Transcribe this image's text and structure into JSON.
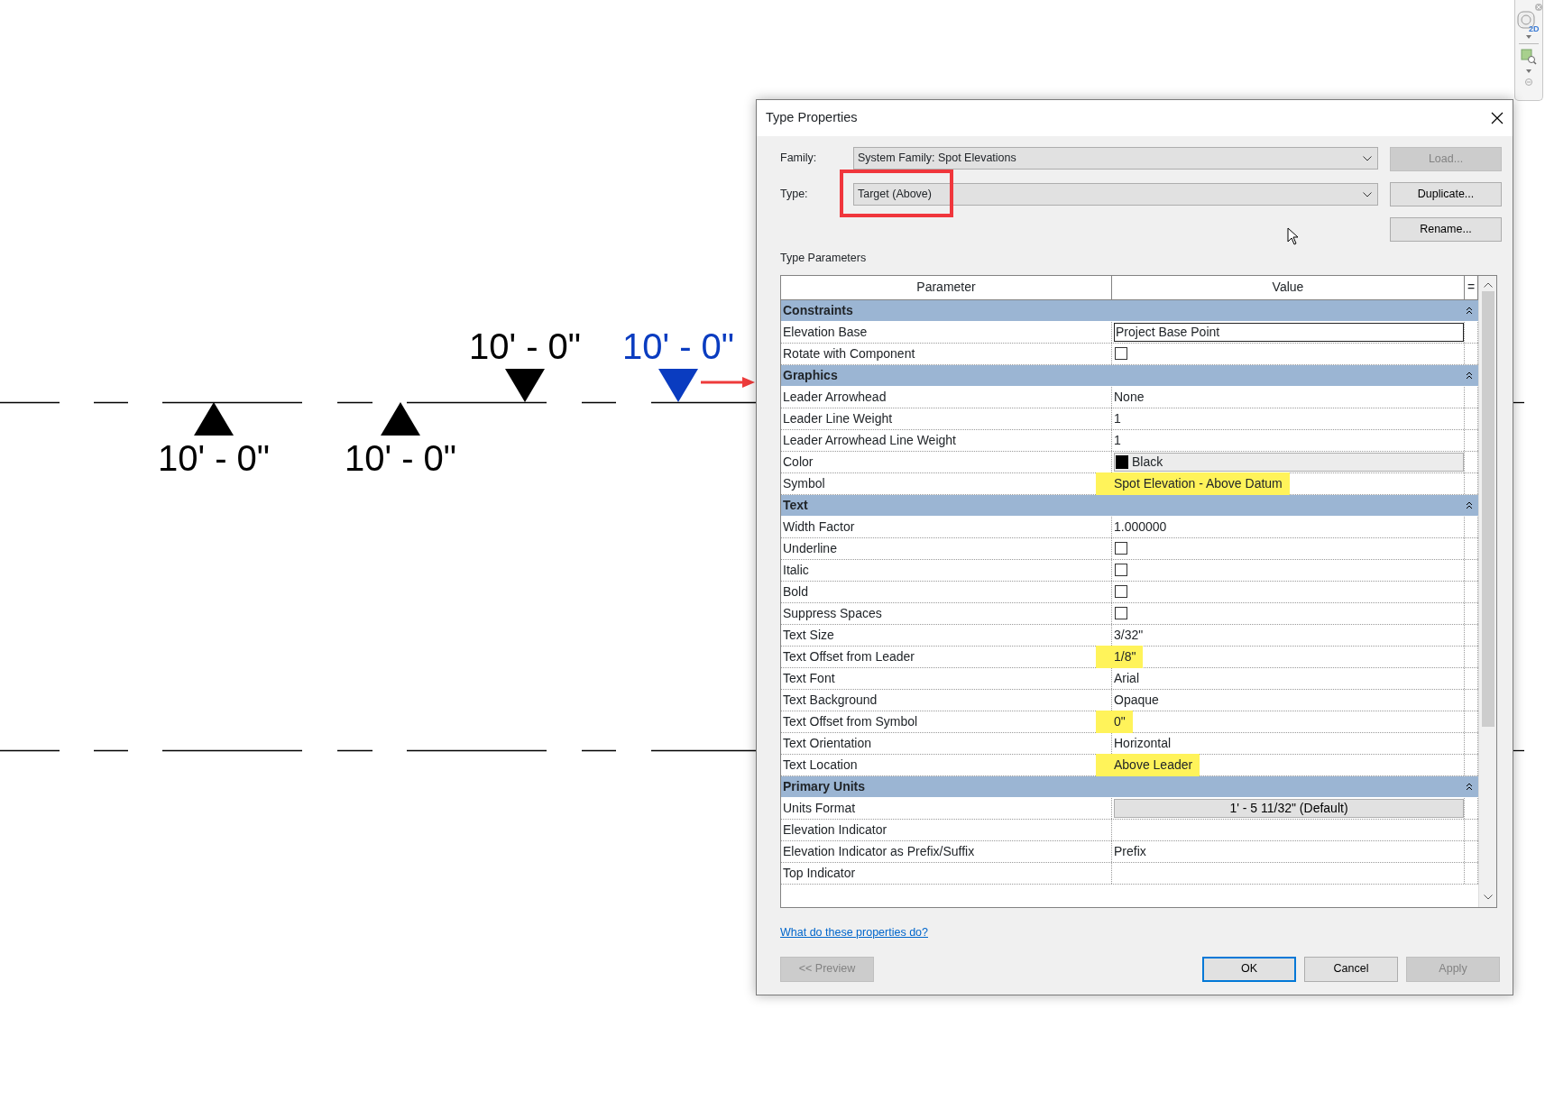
{
  "canvas": {
    "spot_elevations": [
      {
        "label": "10' - 0\"",
        "kind": "up",
        "selected": false
      },
      {
        "label": "10' - 0\"",
        "kind": "up",
        "selected": false
      },
      {
        "label": "10' - 0\"",
        "kind": "down",
        "selected": false
      },
      {
        "label": "10' - 0\"",
        "kind": "down",
        "selected": true
      }
    ]
  },
  "dialog": {
    "title": "Type Properties",
    "family": {
      "label": "Family:",
      "value": "System Family: Spot Elevations"
    },
    "type": {
      "label": "Type:",
      "value": "Target (Above)",
      "highlighted": true
    },
    "side_buttons": [
      {
        "label": "Load...",
        "disabled": true
      },
      {
        "label": "Duplicate...",
        "disabled": false
      },
      {
        "label": "Rename...",
        "disabled": false
      }
    ],
    "section_title": "Type Parameters",
    "table": {
      "columns": [
        "Parameter",
        "Value",
        "="
      ],
      "groups": [
        {
          "name": "Constraints",
          "expanded": true,
          "rows": [
            {
              "parameter": "Elevation Base",
              "kind": "field",
              "value": "Project Base Point"
            },
            {
              "parameter": "Rotate with Component",
              "kind": "checkbox",
              "checked": false
            }
          ]
        },
        {
          "name": "Graphics",
          "expanded": true,
          "rows": [
            {
              "parameter": "Leader Arrowhead",
              "kind": "text",
              "value": "None",
              "highlighted": false
            },
            {
              "parameter": "Leader Line Weight",
              "kind": "text",
              "value": "1",
              "highlighted": false
            },
            {
              "parameter": "Leader Arrowhead Line Weight",
              "kind": "text",
              "value": "1",
              "highlighted": false
            },
            {
              "parameter": "Color",
              "kind": "color",
              "value": "Black",
              "color": "#000000"
            },
            {
              "parameter": "Symbol",
              "kind": "text",
              "value": "Spot Elevation - Above Datum",
              "highlighted": true
            }
          ]
        },
        {
          "name": "Text",
          "expanded": true,
          "rows": [
            {
              "parameter": "Width Factor",
              "kind": "text",
              "value": "1.000000",
              "highlighted": false
            },
            {
              "parameter": "Underline",
              "kind": "checkbox",
              "checked": false
            },
            {
              "parameter": "Italic",
              "kind": "checkbox",
              "checked": false
            },
            {
              "parameter": "Bold",
              "kind": "checkbox",
              "checked": false
            },
            {
              "parameter": "Suppress Spaces",
              "kind": "checkbox",
              "checked": false
            },
            {
              "parameter": "Text Size",
              "kind": "text",
              "value": "3/32\"",
              "highlighted": false
            },
            {
              "parameter": "Text Offset from Leader",
              "kind": "text",
              "value": "1/8\"",
              "highlighted": true
            },
            {
              "parameter": "Text Font",
              "kind": "text",
              "value": "Arial",
              "highlighted": false
            },
            {
              "parameter": "Text Background",
              "kind": "text",
              "value": "Opaque",
              "highlighted": false
            },
            {
              "parameter": "Text Offset from Symbol",
              "kind": "text",
              "value": "0\"",
              "highlighted": true
            },
            {
              "parameter": "Text Orientation",
              "kind": "text",
              "value": "Horizontal",
              "highlighted": false
            },
            {
              "parameter": "Text Location",
              "kind": "text",
              "value": "Above Leader",
              "highlighted": true
            }
          ]
        },
        {
          "name": "Primary Units",
          "expanded": true,
          "rows": [
            {
              "parameter": "Units Format",
              "kind": "button",
              "value": "1' - 5 11/32\" (Default)"
            },
            {
              "parameter": "Elevation Indicator",
              "kind": "text"
            },
            {
              "parameter": "Elevation Indicator as Prefix/Suffix",
              "kind": "text",
              "value": "Prefix",
              "highlighted": false
            },
            {
              "parameter": "Top Indicator",
              "kind": "text"
            }
          ]
        }
      ]
    },
    "help_link": "What do these properties do?",
    "footer_buttons": [
      {
        "label": "<< Preview",
        "disabled": true,
        "default": false
      },
      {
        "label": "OK",
        "disabled": false,
        "default": true
      },
      {
        "label": "Cancel",
        "disabled": false,
        "default": false
      },
      {
        "label": "Apply",
        "disabled": true,
        "default": false
      }
    ]
  },
  "navigation_bar": {
    "view_label": "2D"
  }
}
